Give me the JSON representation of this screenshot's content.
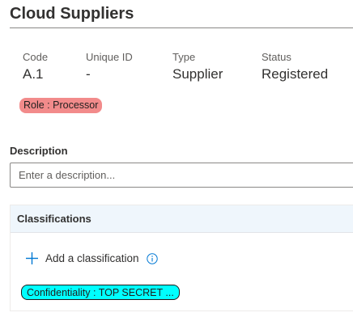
{
  "header": {
    "title": "Cloud Suppliers"
  },
  "fields": {
    "code": {
      "label": "Code",
      "value": "A.1"
    },
    "unique_id": {
      "label": "Unique ID",
      "value": "-"
    },
    "type": {
      "label": "Type",
      "value": "Supplier"
    },
    "status": {
      "label": "Status",
      "value": "Registered"
    }
  },
  "role_badge": {
    "text": "Role : Processor",
    "color": "#f28b8b"
  },
  "description": {
    "label": "Description",
    "value": "",
    "placeholder": "Enter a description..."
  },
  "classifications": {
    "header": "Classifications",
    "add_label": "Add a classification",
    "add_icon": "plus-icon",
    "info_icon": "info-icon",
    "badge": {
      "text": "Confidentiality : TOP SECRET ...",
      "color": "#00ffff"
    }
  },
  "colors": {
    "accent": "#0078d4",
    "header_bg": "#eff6fc"
  }
}
